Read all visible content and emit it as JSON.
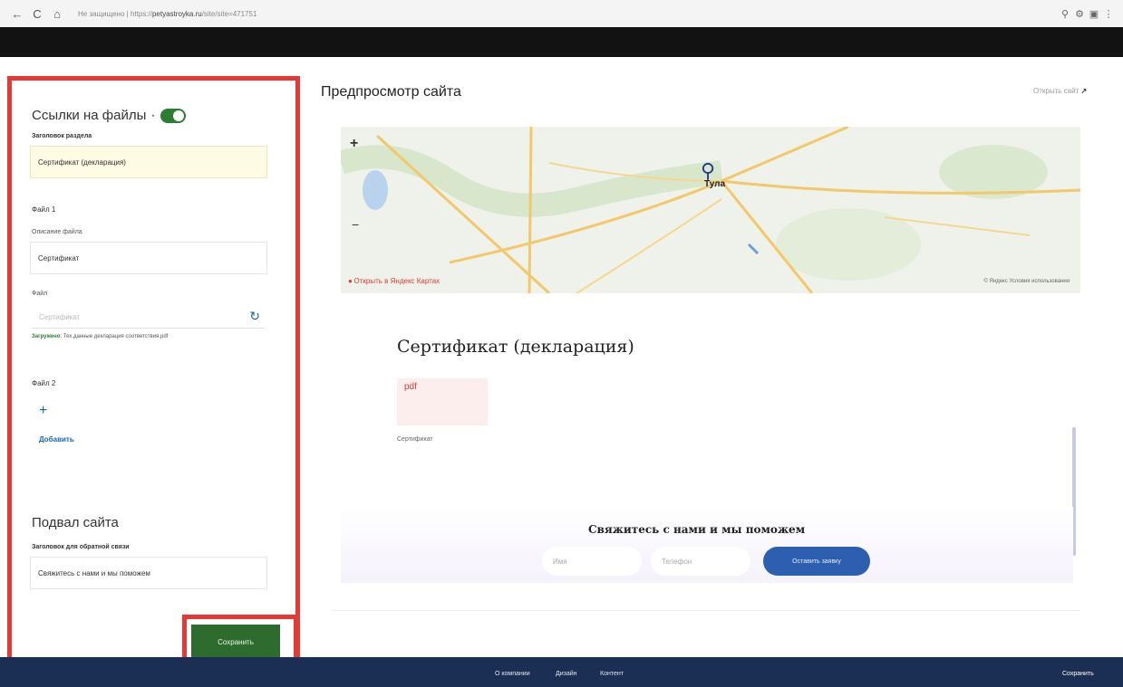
{
  "browser": {
    "back": "←",
    "reload": "C",
    "home": "⌂",
    "security": "Не защищено",
    "url_fragment": "| https://",
    "domain": "petyastroyka.ru",
    "url_path": "/site/site=471751"
  },
  "sidebar": {
    "section_title": "Ссылки на файлы",
    "title_dot": "•",
    "section_heading_label": "Заголовок раздела",
    "section_heading_value": "Сертификат (декларация)",
    "file1_label": "Файл 1",
    "file_desc_label": "Описание файла",
    "file_desc_value": "Сертификат",
    "file_field_label": "Файл",
    "file_input_placeholder": "Сертификат",
    "upload_status": "Загружено",
    "upload_filename": "Тех.данные декларация соответствия.pdf",
    "file2_label": "Файл 2",
    "add_label": "Добавить",
    "footer_title": "Подвал сайта",
    "footer_label": "Заголовок для обратной связи",
    "footer_value": "Свяжитесь с нами и мы поможем",
    "save_label": "Сохранить"
  },
  "preview": {
    "title": "Предпросмотр сайта",
    "open_link": "Открыть сайт",
    "open_arrow": "↗",
    "map": {
      "zoom_in": "+",
      "zoom_out": "−",
      "city": "Тула",
      "open_in_maps": "Открыть в Яндекс Картах",
      "copyright": "© Яндекс Условия использования"
    },
    "cert_heading": "Сертификат (декларация)",
    "pdf_badge": "pdf",
    "pdf_caption": "Сертификат",
    "contact_heading": "Свяжитесь с нами и мы поможем",
    "contact_name_placeholder": "Имя",
    "contact_phone_placeholder": "Телефон",
    "contact_button": "Оставить заявку"
  },
  "bottom_bar": {
    "links": [
      "О компании",
      "Дизайн",
      "Контент"
    ],
    "save": "Сохранить"
  },
  "colors": {
    "highlight": "#e53935",
    "toggle": "#2e7d32",
    "save_button": "#2e6b2f",
    "contact_button": "#2d5fb0",
    "bottom_bar": "#1b2f54"
  }
}
